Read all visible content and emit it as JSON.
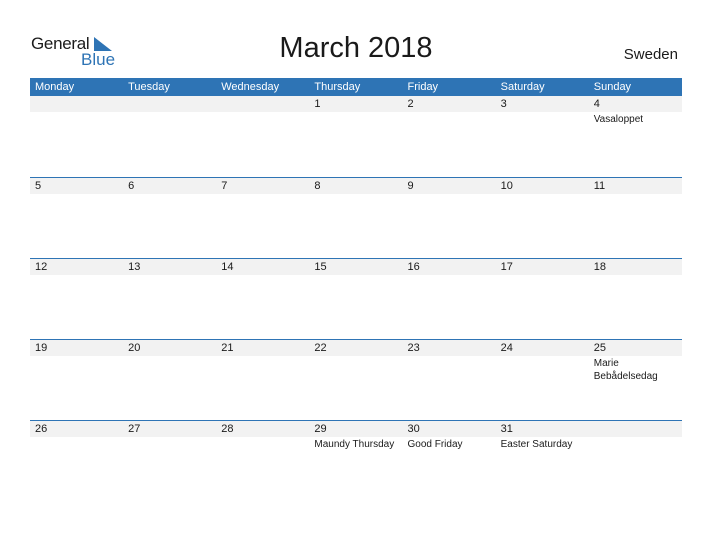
{
  "logo": {
    "general": "General",
    "blue": "Blue"
  },
  "title": "March 2018",
  "country": "Sweden",
  "colors": {
    "accent": "#2e74b5",
    "strip": "#f2f2f2"
  },
  "weekdays": [
    "Monday",
    "Tuesday",
    "Wednesday",
    "Thursday",
    "Friday",
    "Saturday",
    "Sunday"
  ],
  "weeks": [
    [
      {
        "d": ""
      },
      {
        "d": ""
      },
      {
        "d": ""
      },
      {
        "d": "1"
      },
      {
        "d": "2"
      },
      {
        "d": "3"
      },
      {
        "d": "4",
        "e": "Vasaloppet"
      }
    ],
    [
      {
        "d": "5"
      },
      {
        "d": "6"
      },
      {
        "d": "7"
      },
      {
        "d": "8"
      },
      {
        "d": "9"
      },
      {
        "d": "10"
      },
      {
        "d": "11"
      }
    ],
    [
      {
        "d": "12"
      },
      {
        "d": "13"
      },
      {
        "d": "14"
      },
      {
        "d": "15"
      },
      {
        "d": "16"
      },
      {
        "d": "17"
      },
      {
        "d": "18"
      }
    ],
    [
      {
        "d": "19"
      },
      {
        "d": "20"
      },
      {
        "d": "21"
      },
      {
        "d": "22"
      },
      {
        "d": "23"
      },
      {
        "d": "24"
      },
      {
        "d": "25",
        "e": "Marie Bebådelsedag"
      }
    ],
    [
      {
        "d": "26"
      },
      {
        "d": "27"
      },
      {
        "d": "28"
      },
      {
        "d": "29",
        "e": "Maundy Thursday"
      },
      {
        "d": "30",
        "e": "Good Friday"
      },
      {
        "d": "31",
        "e": "Easter Saturday"
      },
      {
        "d": ""
      }
    ]
  ]
}
